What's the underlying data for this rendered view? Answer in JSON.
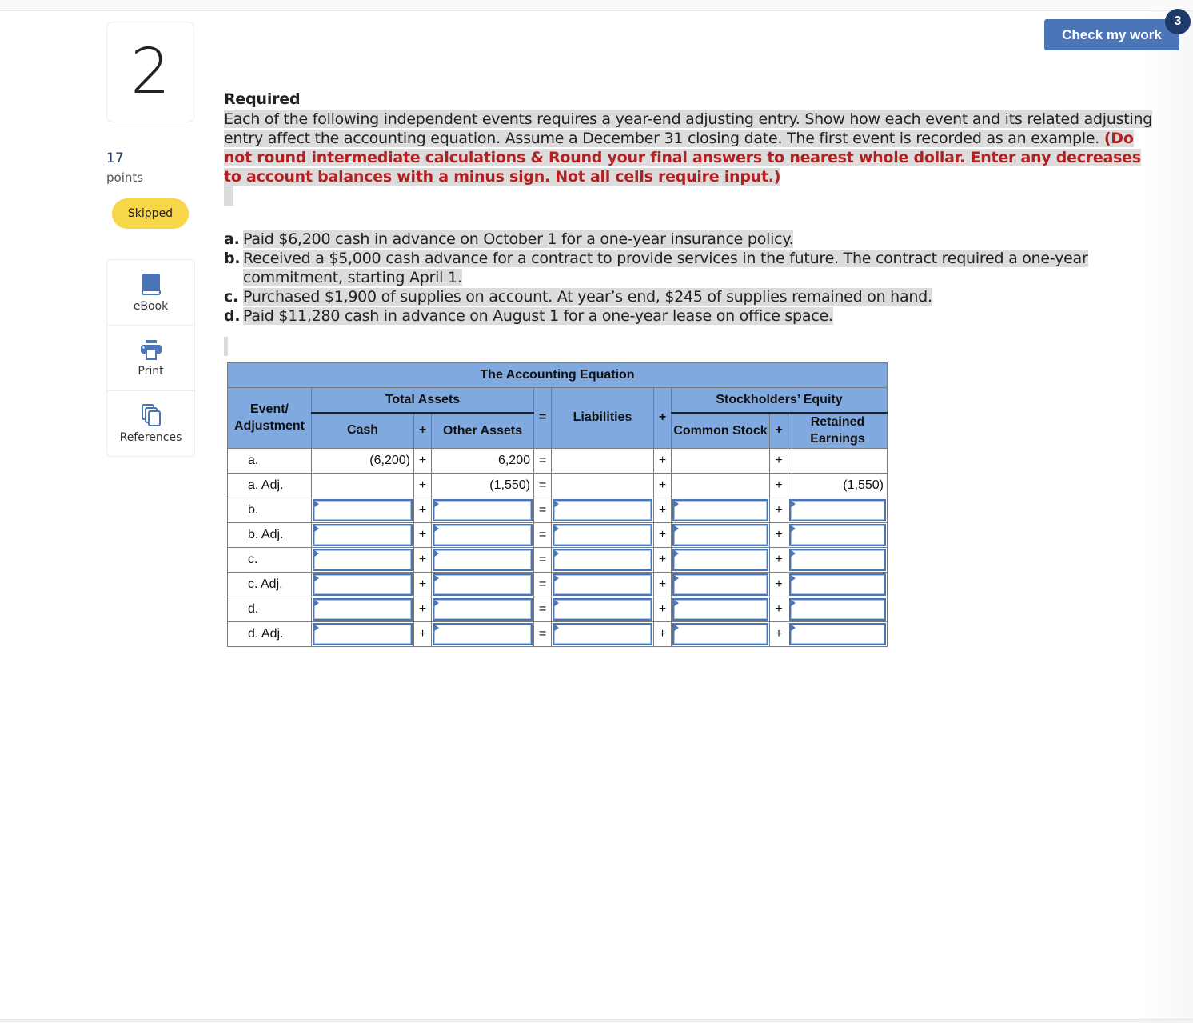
{
  "question": {
    "number": "2",
    "points_value": "17",
    "points_label": "points",
    "status": "Skipped"
  },
  "tools": [
    {
      "label": "eBook",
      "icon": "book-icon"
    },
    {
      "label": "Print",
      "icon": "printer-icon"
    },
    {
      "label": "References",
      "icon": "copy-pages-icon"
    }
  ],
  "header": {
    "check_button": "Check my work",
    "check_badge": "3"
  },
  "required": {
    "title": "Required",
    "text": "Each of the following independent events requires a year-end adjusting entry. Show how each event and its related adjusting entry affect the accounting equation. Assume a December 31 closing date. The first event is recorded as an example. ",
    "instruction": "(Do not round intermediate calculations & Round your final answers to nearest whole dollar. Enter any decreases to account balances with a minus sign. Not all cells require input.)"
  },
  "events": [
    {
      "letter": "a.",
      "text": "Paid $6,200 cash in advance on October 1 for a one-year insurance policy."
    },
    {
      "letter": "b.",
      "text": "Received a $5,000 cash advance for a contract to provide services in the future. The contract required a one-year commitment, starting April 1."
    },
    {
      "letter": "c.",
      "text": "Purchased $1,900 of supplies on account. At year’s end, $245 of supplies remained on hand."
    },
    {
      "letter": "d.",
      "text": "Paid $11,280 cash in advance on August 1 for a one-year lease on office space."
    }
  ],
  "table": {
    "title": "The Accounting Equation",
    "event_header": "Event/ Adjustment",
    "total_assets": "Total Assets",
    "cash": "Cash",
    "other_assets": "Other Assets",
    "liabilities": "Liabilities",
    "stockholders_equity": "Stockholders’ Equity",
    "common_stock": "Common Stock",
    "retained_earnings": "Retained Earnings",
    "op_plus": "+",
    "op_equals": "=",
    "rows": [
      {
        "label": "a.",
        "cash": "(6,200)",
        "other_assets": "6,200",
        "liabilities": "",
        "common_stock": "",
        "retained_earnings": "",
        "editable": false
      },
      {
        "label": "a. Adj.",
        "cash": "",
        "other_assets": "(1,550)",
        "liabilities": "",
        "common_stock": "",
        "retained_earnings": "(1,550)",
        "editable": false
      },
      {
        "label": "b.",
        "cash": "",
        "other_assets": "",
        "liabilities": "",
        "common_stock": "",
        "retained_earnings": "",
        "editable": true
      },
      {
        "label": "b. Adj.",
        "cash": "",
        "other_assets": "",
        "liabilities": "",
        "common_stock": "",
        "retained_earnings": "",
        "editable": true
      },
      {
        "label": "c.",
        "cash": "",
        "other_assets": "",
        "liabilities": "",
        "common_stock": "",
        "retained_earnings": "",
        "editable": true
      },
      {
        "label": "c. Adj.",
        "cash": "",
        "other_assets": "",
        "liabilities": "",
        "common_stock": "",
        "retained_earnings": "",
        "editable": true
      },
      {
        "label": "d.",
        "cash": "",
        "other_assets": "",
        "liabilities": "",
        "common_stock": "",
        "retained_earnings": "",
        "editable": true
      },
      {
        "label": "d. Adj.",
        "cash": "",
        "other_assets": "",
        "liabilities": "",
        "common_stock": "",
        "retained_earnings": "",
        "editable": true
      }
    ]
  },
  "colors": {
    "accent": "#4a76b8",
    "badge": "#1d3a6b",
    "table_header": "#80a9df",
    "skipped": "#f7d648",
    "instruction_red": "#b22020",
    "highlight": "#dcdcdc"
  }
}
